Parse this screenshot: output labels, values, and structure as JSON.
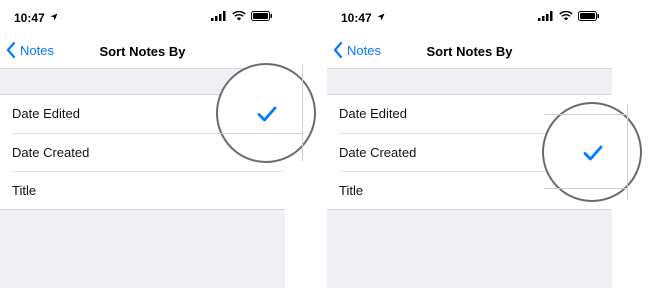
{
  "panels": [
    {
      "status": {
        "time": "10:47"
      },
      "nav": {
        "back_label": "Notes",
        "title": "Sort Notes By"
      },
      "options": [
        "Date Edited",
        "Date Created",
        "Title"
      ],
      "selected": "Date Edited"
    },
    {
      "status": {
        "time": "10:47"
      },
      "nav": {
        "back_label": "Notes",
        "title": "Sort Notes By"
      },
      "options": [
        "Date Edited",
        "Date Created",
        "Title"
      ],
      "selected": "Date Created"
    }
  ],
  "colors": {
    "accent": "#007aff",
    "background": "#efeff4",
    "magnifier_border": "#6b6b6b"
  },
  "icons": [
    "location-arrow-icon",
    "signal-icon",
    "wifi-icon",
    "battery-icon",
    "chevron-left-icon",
    "checkmark-icon"
  ]
}
